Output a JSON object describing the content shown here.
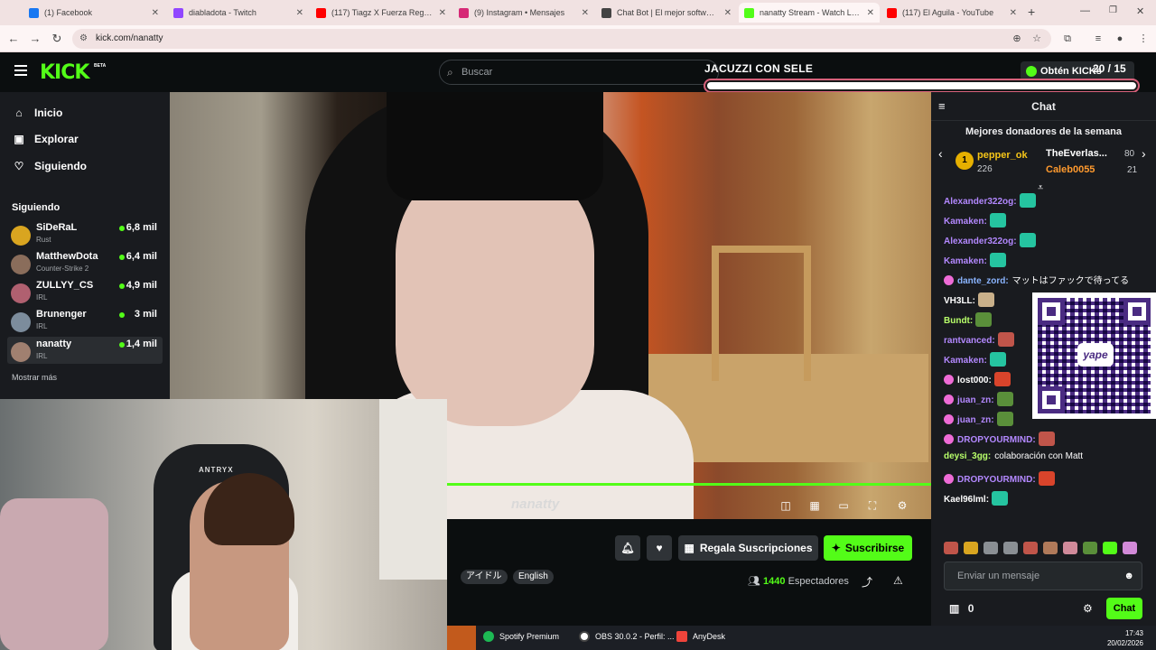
{
  "browser": {
    "tabs": [
      {
        "title": "(1) Facebook",
        "color": "#1877f2"
      },
      {
        "title": "diabladota - Twitch",
        "color": "#9146ff"
      },
      {
        "title": "(117) Tiagz X Fuerza Regida X ...",
        "color": "#ff0000"
      },
      {
        "title": "(9) Instagram • Mensajes",
        "color": "#d62976"
      },
      {
        "title": "Chat Bot | El mejor software pa...",
        "color": "#444444"
      },
      {
        "title": "nanatty Stream - Watch Live...",
        "color": "#53fc18"
      },
      {
        "title": "(117) El Aguila - YouTube",
        "color": "#ff0000"
      }
    ],
    "url": "kick.com/nanatty"
  },
  "header": {
    "logo": "KICK",
    "logo_sup": "BETA",
    "search_placeholder": "Buscar",
    "get_kick": "Obtén KICKs"
  },
  "goal": {
    "title": "JACUZZI CON SELE",
    "count": "20 / 15",
    "progress": 1.0
  },
  "sidebar": {
    "nav": [
      {
        "label": "Inicio",
        "icon": "home-icon",
        "glyph": "⌂"
      },
      {
        "label": "Explorar",
        "icon": "explore-icon",
        "glyph": "▣"
      },
      {
        "label": "Siguiendo",
        "icon": "heart-icon",
        "glyph": "♡"
      }
    ],
    "following_title": "Siguiendo",
    "channels": [
      {
        "name": "SiDeRaL",
        "category": "Rust",
        "viewers": "6,8 mil",
        "color": "#d9a520"
      },
      {
        "name": "MatthewDota",
        "category": "Counter-Strike 2",
        "viewers": "6,4 mil",
        "color": "#8a6d5b"
      },
      {
        "name": "ZULLYY_CS",
        "category": "IRL",
        "viewers": "4,9 mil",
        "color": "#b06070"
      },
      {
        "name": "Brunenger",
        "category": "IRL",
        "viewers": "3 mil",
        "color": "#7c8c9c"
      },
      {
        "name": "nanatty",
        "category": "IRL",
        "viewers": "1,4 mil",
        "color": "#a08070"
      }
    ],
    "show_more": "Mostrar más"
  },
  "video": {
    "watermark": "nanatty",
    "webcam_brand": "ANTRYX"
  },
  "stream_actions": {
    "gift": "Regala Suscripciones",
    "subscribe": "Suscribirse",
    "tags": [
      "アイドル",
      "English"
    ],
    "viewers_count": "1440",
    "viewers_label": "Espectadores"
  },
  "chat": {
    "title": "Chat",
    "donors_title": "Mejores donadores de la semana",
    "donors": [
      {
        "name": "pepper_ok",
        "amount": "226"
      },
      {
        "name": "TheEverlas...",
        "amount": "80"
      },
      {
        "name": "Caleb0055",
        "amount": "21"
      }
    ],
    "messages": [
      {
        "user": "Alexander322og:",
        "text": "",
        "color": "#b388ff",
        "badge": false,
        "emote": "#25c4a0"
      },
      {
        "user": "Kamaken:",
        "text": "",
        "color": "#b388ff",
        "badge": false,
        "emote": "#25c4a0"
      },
      {
        "user": "Alexander322og:",
        "text": "",
        "color": "#b388ff",
        "badge": false,
        "emote": "#25c4a0"
      },
      {
        "user": "Kamaken:",
        "text": "",
        "color": "#b388ff",
        "badge": false,
        "emote": "#25c4a0"
      },
      {
        "user": "dante_zord:",
        "text": "マットはファックで待ってる",
        "color": "#8ab4ff",
        "badge": true,
        "emote": ""
      },
      {
        "user": "VH3LL:",
        "text": "",
        "color": "#ffffff",
        "badge": false,
        "emote": "#c9b08a"
      },
      {
        "user": "Bundt:",
        "text": "",
        "color": "#b8ff6a",
        "badge": false,
        "emote": "#5a8f3a"
      },
      {
        "user": "rantvanced:",
        "text": "",
        "color": "#b388ff",
        "badge": false,
        "emote": "#c0554a"
      },
      {
        "user": "Kamaken:",
        "text": "",
        "color": "#b388ff",
        "badge": false,
        "emote": "#25c4a0"
      },
      {
        "user": "lost000:",
        "text": "",
        "color": "#ffffff",
        "badge": true,
        "emote": "#d9442b"
      },
      {
        "user": "juan_zn:",
        "text": "",
        "color": "#b388ff",
        "badge": true,
        "emote": "#5a8f3a"
      },
      {
        "user": "juan_zn:",
        "text": "",
        "color": "#b388ff",
        "badge": true,
        "emote": "#5a8f3a"
      },
      {
        "user": "DROPYOURMIND:",
        "text": "",
        "color": "#b388ff",
        "badge": true,
        "emote": "#c0554a"
      },
      {
        "user": "deysi_3gg:",
        "text": "colaboración con Matt",
        "color": "#b8ff6a",
        "badge": false,
        "emote": ""
      },
      {
        "user": "DROPYOURMIND:",
        "text": "",
        "color": "#b388ff",
        "badge": true,
        "emote": "#d9442b"
      },
      {
        "user": "Kael96lml:",
        "text": "",
        "color": "#ffffff",
        "badge": false,
        "emote": "#25c4a0"
      }
    ],
    "input_placeholder": "Enviar un mensaje",
    "points": "0",
    "send_label": "Chat",
    "qr_label": "yape"
  },
  "taskbar": {
    "apps": [
      "Spotify Premium",
      "OBS 30.0.2 - Perfil: ...",
      "AnyDesk"
    ],
    "time": "17:43",
    "date": "20/02/2026"
  }
}
